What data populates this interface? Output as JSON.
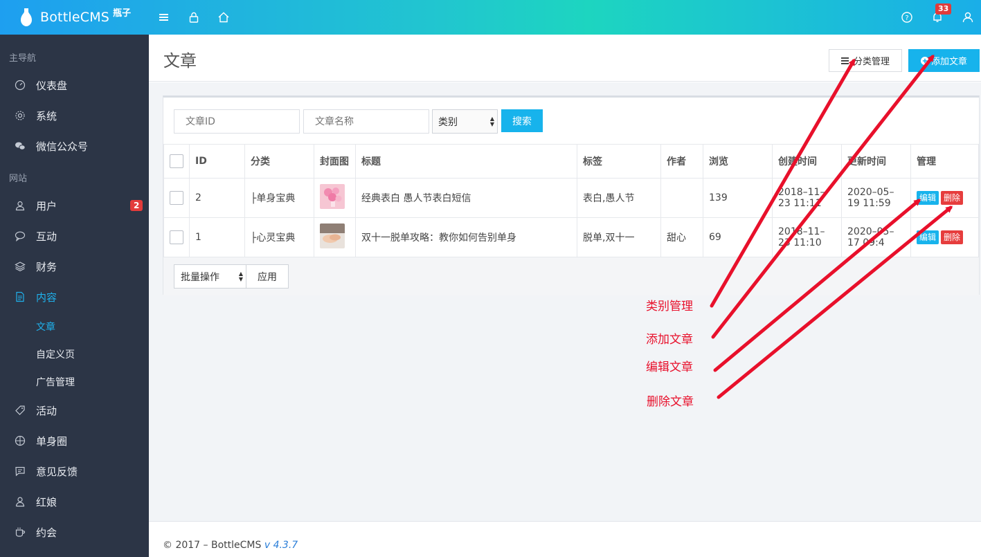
{
  "topbar": {
    "brand": "BottleCMS",
    "brand_sub": "瓶子",
    "notification_count": "33",
    "icons": [
      "menu-icon",
      "lock-icon",
      "home-icon",
      "help-icon",
      "bell-icon",
      "user-icon"
    ]
  },
  "sidebar": {
    "header_main": "主导航",
    "header_site": "网站",
    "items": [
      {
        "label": "仪表盘",
        "icon": "dashboard-icon"
      },
      {
        "label": "系统",
        "icon": "gear-icon"
      },
      {
        "label": "微信公众号",
        "icon": "wechat-icon"
      },
      {
        "label": "用户",
        "icon": "user-icon",
        "badge": "2"
      },
      {
        "label": "互动",
        "icon": "comment-icon"
      },
      {
        "label": "财务",
        "icon": "layers-icon"
      },
      {
        "label": "内容",
        "icon": "document-icon"
      },
      {
        "label": "活动",
        "icon": "tag-icon"
      },
      {
        "label": "单身圈",
        "icon": "circle-icon"
      },
      {
        "label": "意见反馈",
        "icon": "message-icon"
      },
      {
        "label": "红娘",
        "icon": "person-icon"
      },
      {
        "label": "约会",
        "icon": "coffee-icon"
      }
    ],
    "sub_items": [
      "文章",
      "自定义页",
      "广告管理"
    ]
  },
  "page": {
    "title": "文章",
    "btn_category": "分类管理",
    "btn_add": "添加文章"
  },
  "search": {
    "id_placeholder": "文章ID",
    "name_placeholder": "文章名称",
    "category_select": "类别",
    "search_button": "搜索"
  },
  "table": {
    "headers": [
      "ID",
      "分类",
      "封面图",
      "标题",
      "标签",
      "作者",
      "浏览",
      "创建时间",
      "更新时间",
      "管理"
    ],
    "rows": [
      {
        "id": "2",
        "category": "├单身宝典",
        "title": "经典表白 愚人节表白短信",
        "tags": "表白,愚人节",
        "author": "",
        "views": "139",
        "created": "2018–11–23 11:11",
        "updated": "2020–05–19 11:59"
      },
      {
        "id": "1",
        "category": "├心灵宝典",
        "title": "双十一脱单攻略：教你如何告别单身",
        "tags": "脱单,双十一",
        "author": "甜心",
        "views": "69",
        "created": "2018–11–23 11:10",
        "updated": "2020–05–17 09:4"
      }
    ],
    "edit_label": "编辑",
    "delete_label": "删除"
  },
  "batch": {
    "select": "批量操作",
    "apply": "应用"
  },
  "footer": {
    "text": "© 2017 – BottleCMS ",
    "version": "v 4.3.7"
  },
  "annotations": [
    "类别管理",
    "添加文章",
    "编辑文章",
    "删除文章"
  ],
  "colors": {
    "accent": "#17b3ec",
    "danger": "#e63d3d",
    "sidebar": "#2c3546",
    "annotation": "#e8102b"
  }
}
